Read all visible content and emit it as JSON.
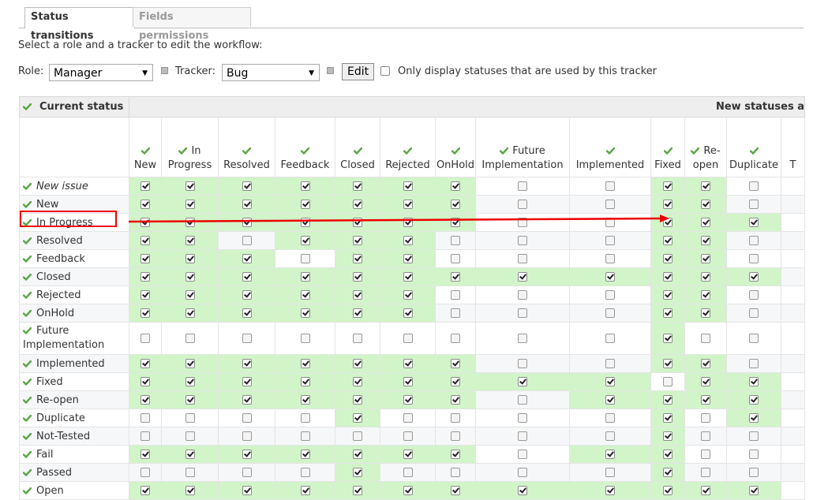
{
  "tabs": [
    {
      "label": "Status transitions",
      "selected": true
    },
    {
      "label": "Fields permissions",
      "selected": false
    }
  ],
  "intro_text": "Select a role and a tracker to edit the workflow:",
  "filter": {
    "role_label": "Role:",
    "role_value": "Manager",
    "tracker_label": "Tracker:",
    "tracker_value": "Bug",
    "edit_button": "Edit",
    "only_used_label": "Only display statuses that are used by this tracker",
    "only_used_checked": false
  },
  "table": {
    "current_status_header": "Current status",
    "new_statuses_header": "New statuses a",
    "columns": [
      {
        "label_lines": [
          "",
          "New"
        ]
      },
      {
        "label_lines": [
          "In",
          "Progress"
        ]
      },
      {
        "label_lines": [
          "",
          "Resolved"
        ]
      },
      {
        "label_lines": [
          "",
          "Feedback"
        ]
      },
      {
        "label_lines": [
          "",
          "Closed"
        ]
      },
      {
        "label_lines": [
          "",
          "Rejected"
        ]
      },
      {
        "label_lines": [
          "",
          "OnHold"
        ]
      },
      {
        "label_lines": [
          "Future",
          "Implementation"
        ]
      },
      {
        "label_lines": [
          "",
          "Implemented"
        ]
      },
      {
        "label_lines": [
          "",
          "Fixed"
        ]
      },
      {
        "label_lines": [
          "Re-",
          "open"
        ]
      },
      {
        "label_lines": [
          "",
          "Duplicate"
        ]
      },
      {
        "label_lines": [
          "",
          "T"
        ]
      }
    ],
    "rows": [
      {
        "label": "New issue",
        "italic": true,
        "values": [
          1,
          1,
          1,
          1,
          1,
          1,
          1,
          0,
          0,
          1,
          1,
          0,
          null
        ]
      },
      {
        "label": "New",
        "values": [
          1,
          1,
          1,
          1,
          1,
          1,
          1,
          0,
          0,
          1,
          1,
          0,
          null
        ]
      },
      {
        "label": "In Progress",
        "values": [
          1,
          1,
          1,
          1,
          1,
          1,
          1,
          0,
          0,
          1,
          1,
          1,
          null
        ]
      },
      {
        "label": "Resolved",
        "values": [
          1,
          1,
          0,
          1,
          1,
          1,
          0,
          0,
          0,
          1,
          1,
          0,
          null
        ]
      },
      {
        "label": "Feedback",
        "values": [
          1,
          1,
          1,
          0,
          1,
          1,
          0,
          0,
          0,
          1,
          1,
          0,
          null
        ]
      },
      {
        "label": "Closed",
        "values": [
          1,
          1,
          1,
          1,
          1,
          1,
          1,
          1,
          1,
          1,
          1,
          1,
          null
        ]
      },
      {
        "label": "Rejected",
        "values": [
          1,
          1,
          1,
          1,
          1,
          1,
          0,
          0,
          0,
          1,
          1,
          0,
          null
        ]
      },
      {
        "label": "OnHold",
        "values": [
          1,
          1,
          1,
          1,
          1,
          1,
          0,
          0,
          0,
          1,
          1,
          0,
          null
        ]
      },
      {
        "label": "Future Implementation",
        "values": [
          0,
          0,
          0,
          0,
          0,
          0,
          0,
          0,
          0,
          1,
          0,
          0,
          null
        ]
      },
      {
        "label": "Implemented",
        "values": [
          1,
          1,
          1,
          1,
          1,
          1,
          1,
          0,
          0,
          1,
          1,
          0,
          null
        ]
      },
      {
        "label": "Fixed",
        "values": [
          1,
          1,
          1,
          1,
          1,
          1,
          1,
          1,
          1,
          0,
          1,
          1,
          null
        ]
      },
      {
        "label": "Re-open",
        "values": [
          1,
          1,
          1,
          1,
          1,
          1,
          1,
          0,
          1,
          1,
          1,
          1,
          null
        ]
      },
      {
        "label": "Duplicate",
        "values": [
          0,
          0,
          0,
          0,
          1,
          0,
          0,
          0,
          0,
          1,
          0,
          1,
          null
        ]
      },
      {
        "label": "Not-Tested",
        "values": [
          0,
          0,
          0,
          0,
          0,
          0,
          0,
          0,
          0,
          1,
          0,
          0,
          null
        ]
      },
      {
        "label": "Fail",
        "values": [
          1,
          1,
          1,
          1,
          1,
          1,
          1,
          0,
          1,
          1,
          0,
          0,
          null
        ]
      },
      {
        "label": "Passed",
        "values": [
          0,
          0,
          0,
          0,
          1,
          0,
          0,
          0,
          0,
          1,
          0,
          0,
          null
        ]
      },
      {
        "label": "Open",
        "values": [
          1,
          1,
          1,
          1,
          1,
          1,
          1,
          1,
          1,
          1,
          1,
          1,
          null
        ]
      }
    ]
  },
  "annotation": {
    "highlighted_row": "In Progress",
    "highlight_color": "#e00000"
  },
  "colors": {
    "enabled_cell": "#d1f5c9",
    "check_icon": "#5aa646"
  }
}
